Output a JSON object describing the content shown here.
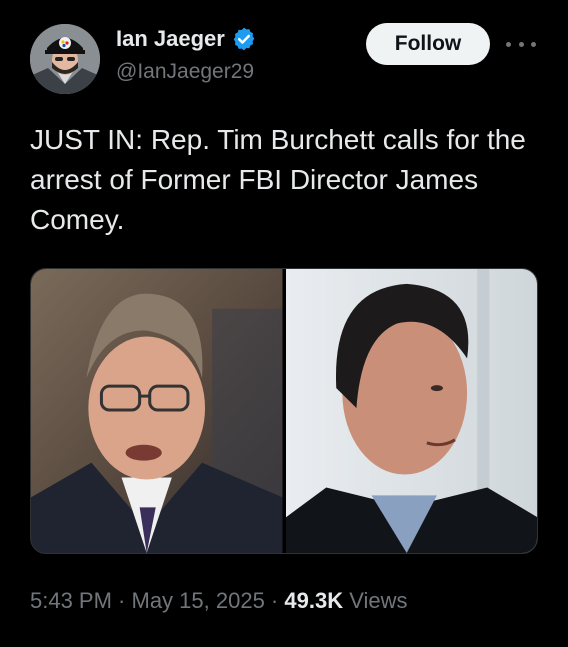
{
  "author": {
    "display_name": "Ian Jaeger",
    "handle": "@IanJaeger29",
    "verified": true,
    "verified_color": "#1d9bf0",
    "avatar_icon": "profile-avatar"
  },
  "actions": {
    "follow_label": "Follow",
    "more_icon": "more-options-icon"
  },
  "tweet": {
    "text": "JUST IN: Rep. Tim Burchett calls for the arrest of Former FBI Director James Comey.",
    "images": [
      {
        "name": "left-photo"
      },
      {
        "name": "right-photo"
      }
    ]
  },
  "meta": {
    "time": "5:43 PM",
    "separator": " · ",
    "date": "May 15, 2025",
    "views_count": "49.3K",
    "views_label": " Views"
  },
  "colors": {
    "background": "#000000",
    "text_primary": "#e7e9ea",
    "text_secondary": "#71767b",
    "follow_bg": "#eff3f4"
  }
}
